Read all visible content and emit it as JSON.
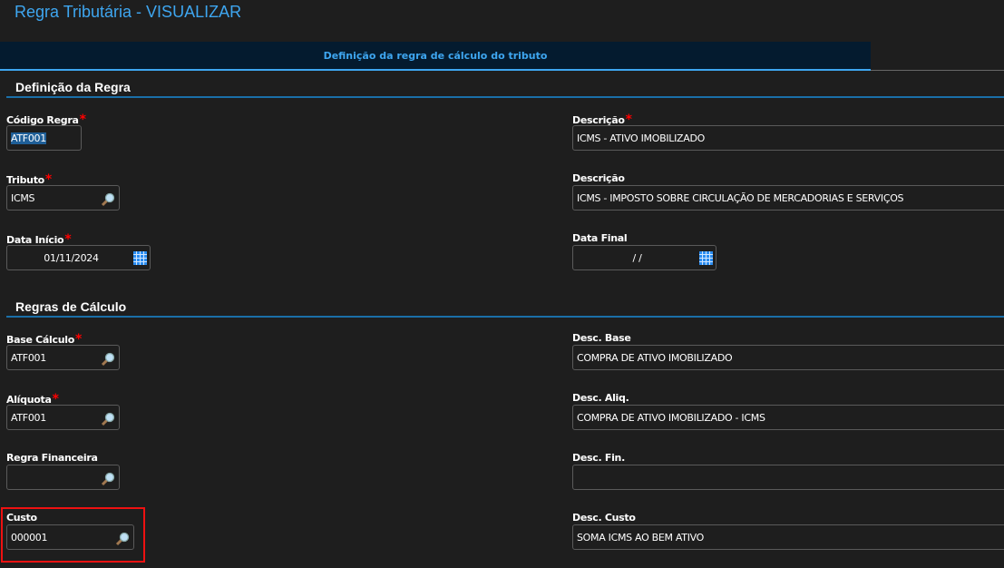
{
  "title": "Regra Tributária - VISUALIZAR",
  "tab": "Definição da regra de cálculo do tributo",
  "sections": {
    "definicao": "Definição da Regra",
    "calculo": "Regras de Cálculo"
  },
  "fields": {
    "codigo": {
      "label": "Código Regra",
      "value": "ATF001"
    },
    "descricao": {
      "label": "Descrição",
      "value": "ICMS - ATIVO IMOBILIZADO"
    },
    "tributo": {
      "label": "Tributo",
      "value": "ICMS"
    },
    "desc_tributo": {
      "label": "Descrição",
      "value": "ICMS - IMPOSTO SOBRE CIRCULAÇÃO DE MERCADORIAS E SERVIÇOS"
    },
    "data_inicio": {
      "label": "Data Início",
      "value": "01/11/2024"
    },
    "data_final": {
      "label": "Data Final",
      "value": " /  /"
    },
    "base": {
      "label": "Base Cálculo",
      "value": "ATF001"
    },
    "desc_base": {
      "label": "Desc. Base",
      "value": "COMPRA DE ATIVO IMOBILIZADO"
    },
    "aliquota": {
      "label": "Alíquota",
      "value": "ATF001"
    },
    "desc_aliq": {
      "label": "Desc. Aliq.",
      "value": "COMPRA DE ATIVO IMOBILIZADO - ICMS"
    },
    "financeira": {
      "label": "Regra Financeira",
      "value": ""
    },
    "desc_fin": {
      "label": "Desc. Fin.",
      "value": ""
    },
    "custo": {
      "label": "Custo",
      "value": "000001"
    },
    "desc_custo": {
      "label": "Desc. Custo",
      "value": "SOMA ICMS AO BEM ATIVO"
    }
  },
  "required_mark": "*"
}
